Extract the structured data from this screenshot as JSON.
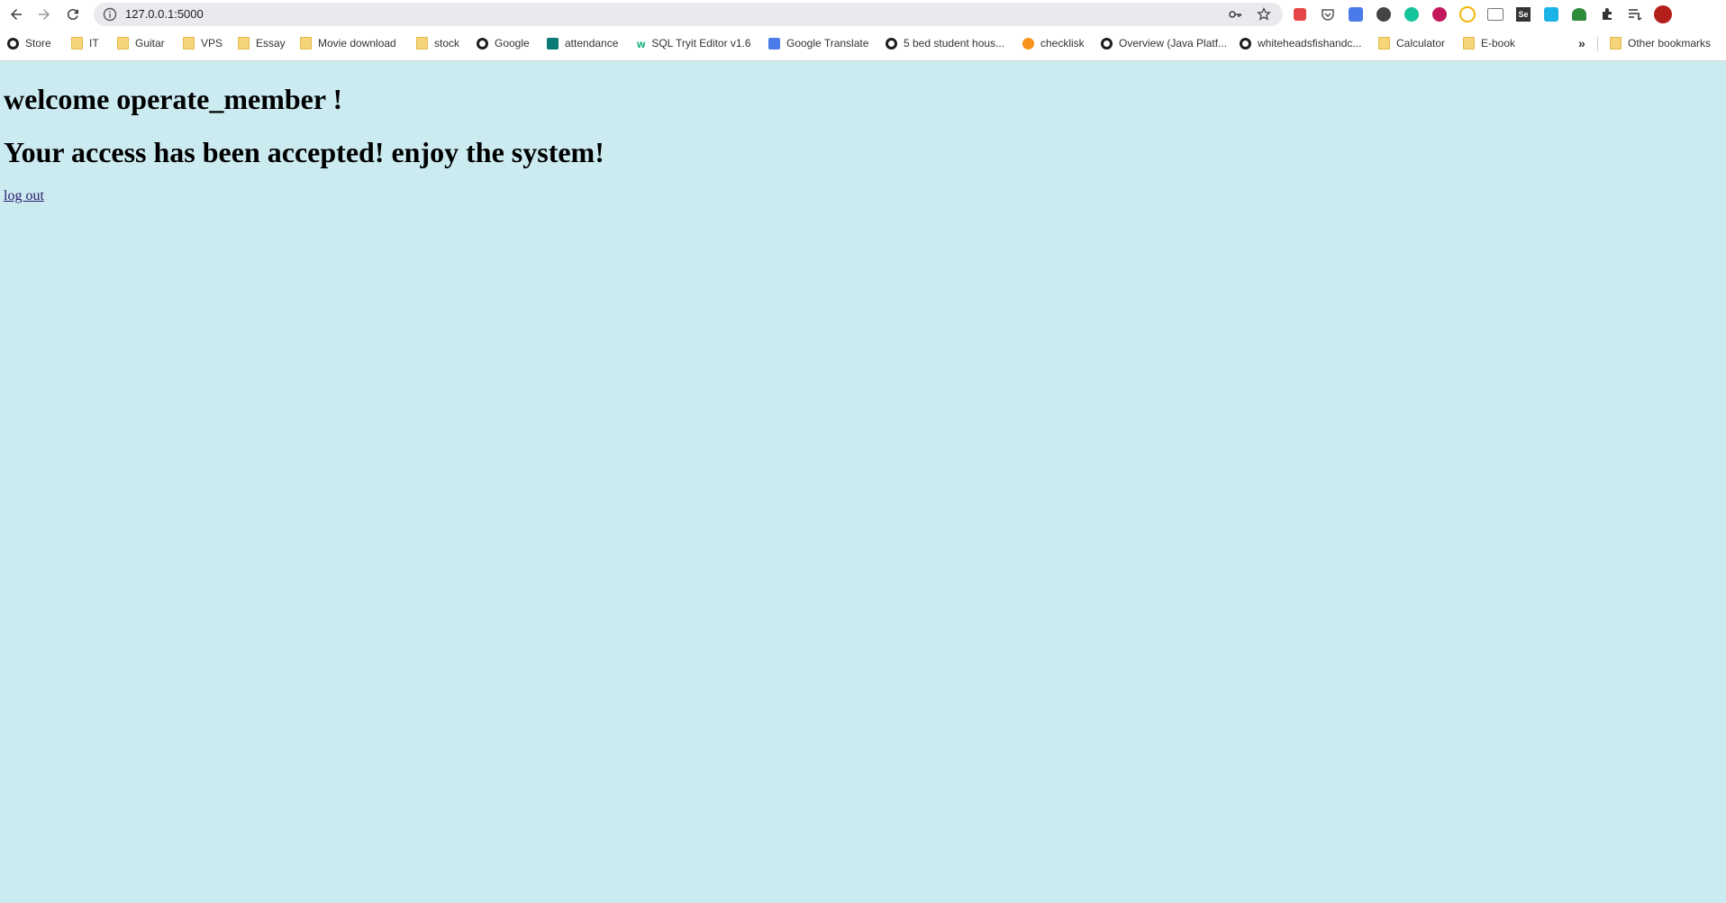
{
  "browser": {
    "url": "127.0.0.1:5000",
    "bookmarks": [
      {
        "label": "Store",
        "icon": "globe-icon"
      },
      {
        "label": "IT",
        "icon": "folder-icon"
      },
      {
        "label": "Guitar",
        "icon": "folder-icon"
      },
      {
        "label": "VPS",
        "icon": "folder-icon"
      },
      {
        "label": "Essay",
        "icon": "folder-icon"
      },
      {
        "label": "Movie download",
        "icon": "folder-icon"
      },
      {
        "label": "stock",
        "icon": "folder-icon"
      },
      {
        "label": "Google",
        "icon": "globe-icon"
      },
      {
        "label": "attendance",
        "icon": "forms-icon"
      },
      {
        "label": "SQL Tryit Editor v1.6",
        "icon": "w3schools-icon"
      },
      {
        "label": "Google Translate",
        "icon": "translate-icon"
      },
      {
        "label": "5 bed student hous...",
        "icon": "globe-icon"
      },
      {
        "label": "checklisk",
        "icon": "bitcoin-icon"
      },
      {
        "label": "Overview (Java Platf...",
        "icon": "globe-icon"
      },
      {
        "label": "whiteheadsfishandc...",
        "icon": "globe-icon"
      },
      {
        "label": "Calculator",
        "icon": "folder-icon"
      },
      {
        "label": "E-book",
        "icon": "folder-icon"
      }
    ],
    "overflow_label": "»",
    "other_bookmarks": "Other bookmarks"
  },
  "page": {
    "welcome": "welcome operate_member !",
    "message": "Your access has been accepted! enjoy the system!",
    "logout_label": "log out"
  },
  "colors": {
    "background": "#cbebf1",
    "folder": "#f6d57a"
  }
}
